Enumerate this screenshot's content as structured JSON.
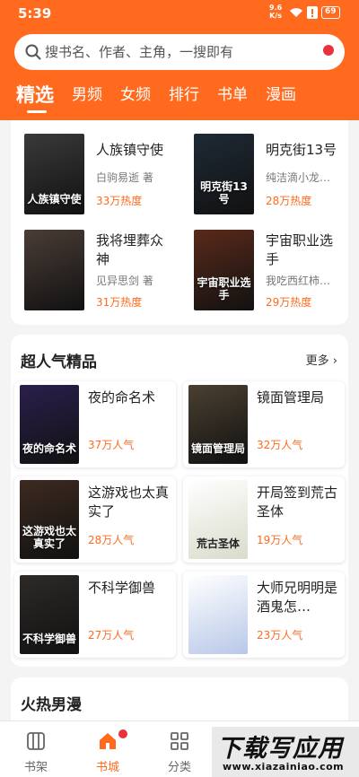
{
  "status": {
    "time": "5:39",
    "net_value": "9.6",
    "net_unit": "K/s",
    "battery": "69"
  },
  "search": {
    "placeholder": "搜书名、作者、主角，一搜即有"
  },
  "tabs": [
    {
      "label": "精选",
      "active": true
    },
    {
      "label": "男频"
    },
    {
      "label": "女频"
    },
    {
      "label": "排行"
    },
    {
      "label": "书单"
    },
    {
      "label": "漫画"
    }
  ],
  "featured": [
    {
      "title": "人族镇守使",
      "author": "白驹易逝 著",
      "heat": "33万热度",
      "cover_text": "人族镇守使",
      "cover_color": "#3a3a3a"
    },
    {
      "title": "明克街13号",
      "author": "纯洁滴小龙…",
      "heat": "28万热度",
      "cover_text": "明克街13号",
      "cover_color": "#1e2a36"
    },
    {
      "title": "我将埋葬众神",
      "author": "见异思剑 著",
      "heat": "31万热度",
      "cover_text": "",
      "cover_color": "#4a3d36"
    },
    {
      "title": "宇宙职业选手",
      "author": "我吃西红柿…",
      "heat": "29万热度",
      "cover_text": "宇宙职业选手",
      "cover_color": "#5a2a1a"
    }
  ],
  "popular": {
    "title": "超人气精品",
    "more": "更多",
    "items": [
      {
        "title": "夜的命名术",
        "heat": "37万人气",
        "cover_text": "夜的命名术",
        "cover_color": "#2a1f4d"
      },
      {
        "title": "镜面管理局",
        "heat": "32万人气",
        "cover_text": "镜面管理局",
        "cover_color": "#4a4030"
      },
      {
        "title": "这游戏也太真实了",
        "heat": "28万人气",
        "cover_text": "这游戏也太真实了",
        "cover_color": "#3d2a20"
      },
      {
        "title": "开局签到荒古圣体",
        "heat": "19万人气",
        "cover_text": "荒古圣体",
        "cover_color": "#d8dccb"
      },
      {
        "title": "不科学御兽",
        "heat": "27万人气",
        "cover_text": "不科学御兽",
        "cover_color": "#2d2a28"
      },
      {
        "title": "大师兄明明是酒鬼怎…",
        "heat": "23万人气",
        "cover_text": "",
        "cover_color": "#b8c8e8"
      }
    ]
  },
  "section3": {
    "title": "火热男漫"
  },
  "nav": [
    {
      "label": "书架",
      "icon": "bookshelf-icon"
    },
    {
      "label": "书城",
      "icon": "home-icon",
      "active": true
    },
    {
      "label": "分类",
      "icon": "category-icon"
    }
  ],
  "watermark": {
    "main": "下载写应用",
    "sub": "www.xiazainiao.com"
  },
  "colors": {
    "accent": "#ff6a1f",
    "badge": "#e8323c"
  }
}
